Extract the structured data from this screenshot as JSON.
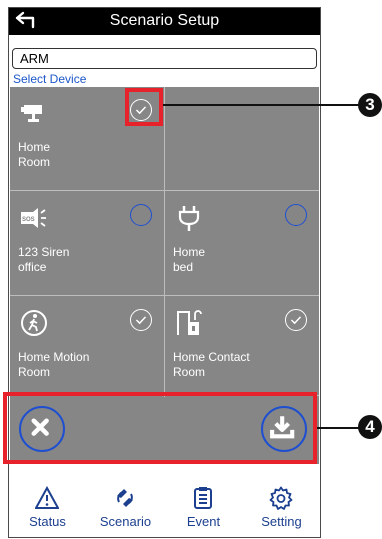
{
  "header": {
    "title": "Scenario Setup"
  },
  "scenario_name": "ARM",
  "select_label": "Select Device",
  "devices": [
    {
      "line1": "Home",
      "line2": "Room",
      "icon": "camera-icon",
      "checked": true
    },
    {
      "line1": "",
      "line2": "",
      "icon": "",
      "checked": false
    },
    {
      "line1": "123 Siren",
      "line2": "office",
      "icon": "siren-icon",
      "checked": false
    },
    {
      "line1": "Home",
      "line2": "bed",
      "icon": "plug-icon",
      "checked": false
    },
    {
      "line1": "Home Motion",
      "line2": "Room",
      "icon": "motion-sensor-icon",
      "checked": true
    },
    {
      "line1": "Home Contact",
      "line2": "Room",
      "icon": "door-contact-icon",
      "checked": true
    }
  ],
  "callouts": {
    "a": "3",
    "b": "4"
  },
  "tabs": [
    {
      "label": "Status",
      "icon": "warning-triangle-icon"
    },
    {
      "label": "Scenario",
      "icon": "scenario-icon"
    },
    {
      "label": "Event",
      "icon": "event-list-icon"
    },
    {
      "label": "Setting",
      "icon": "gear-icon"
    }
  ],
  "colors": {
    "tile": "#868686",
    "accent": "#1e4fd0",
    "highlight": "#e8222b"
  }
}
